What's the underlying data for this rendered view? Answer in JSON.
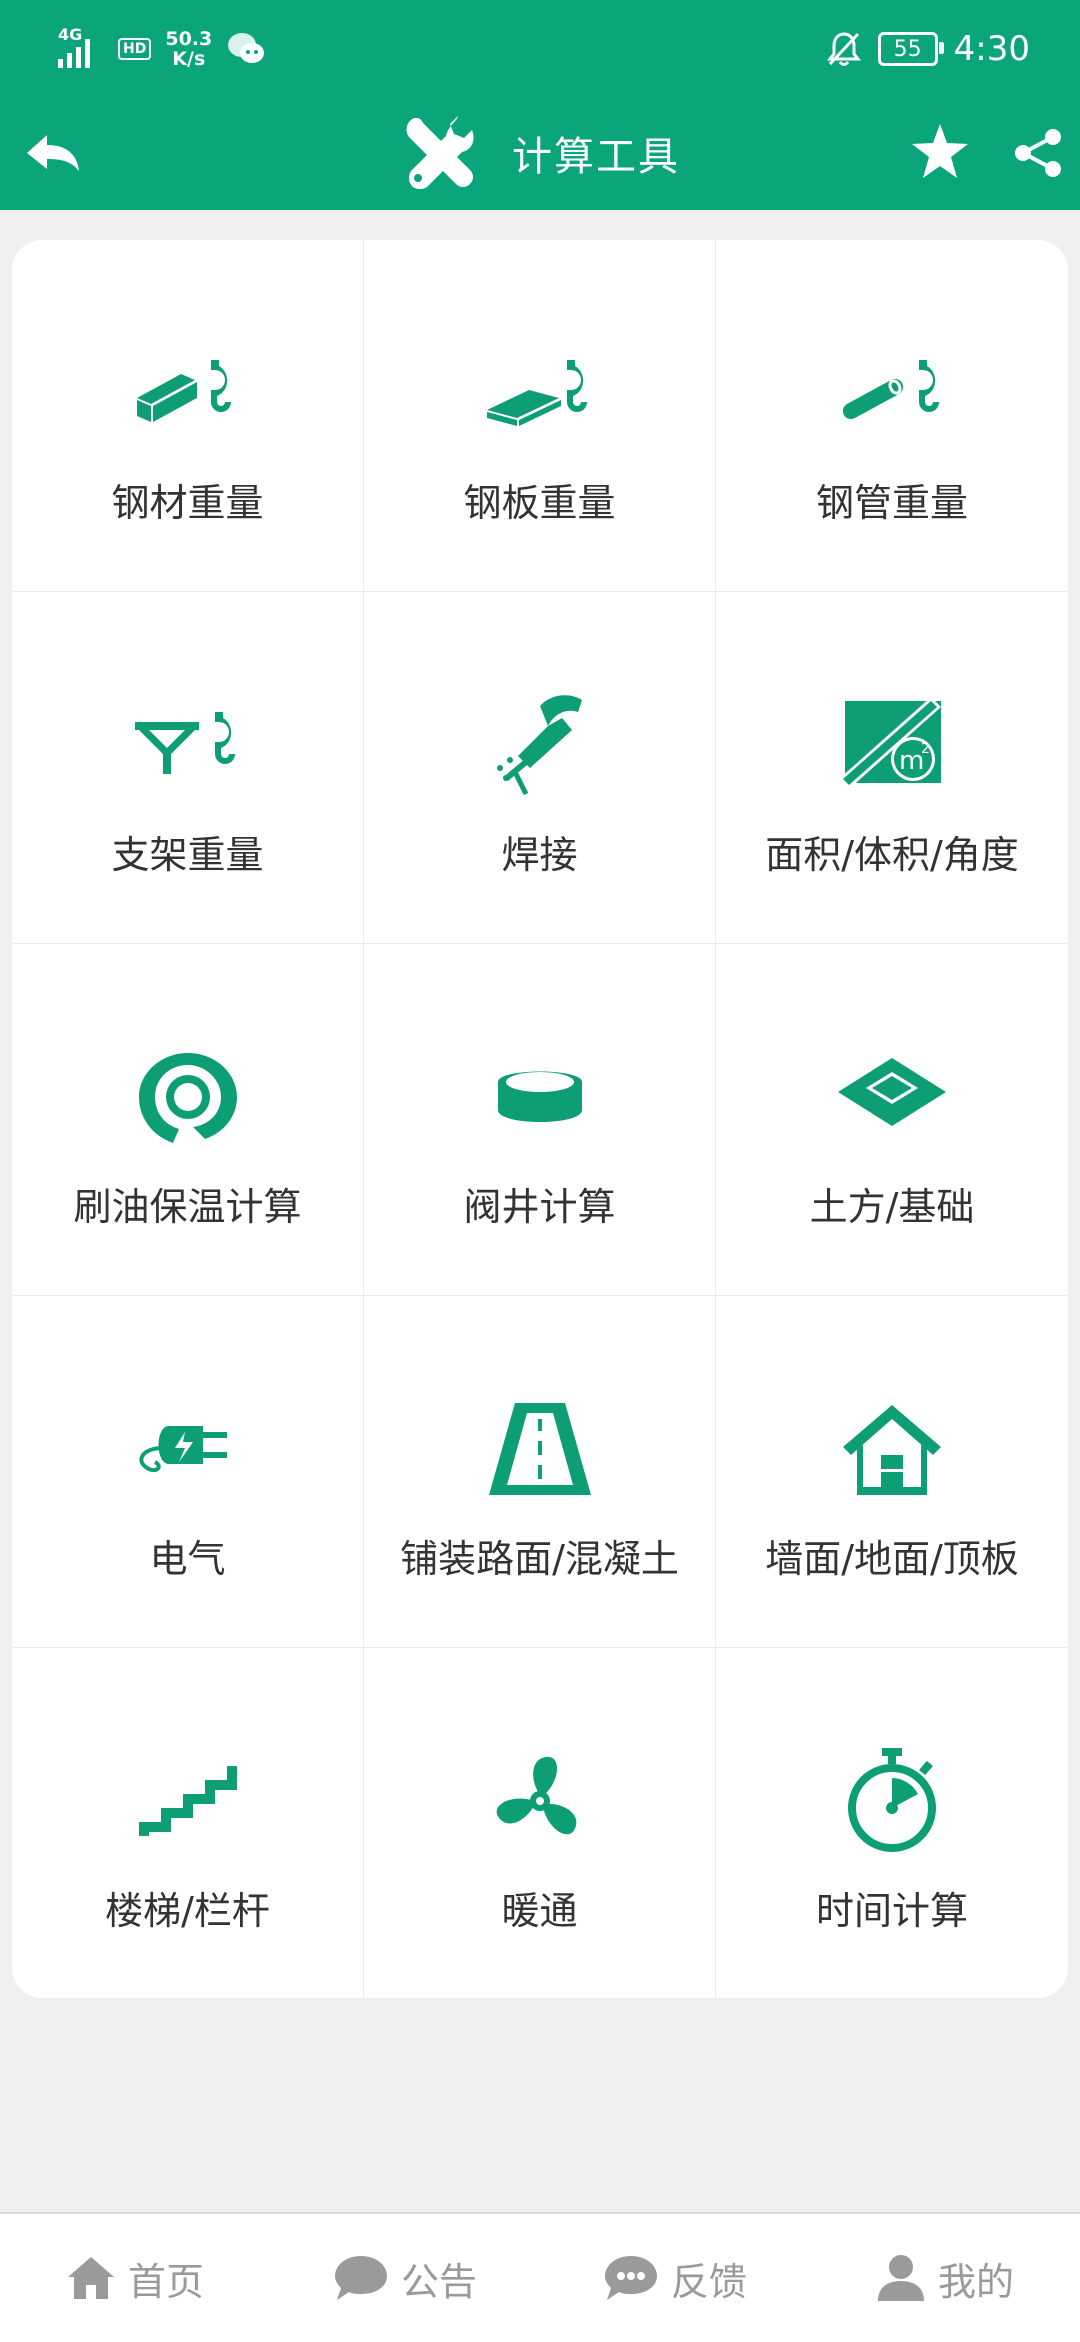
{
  "status_bar": {
    "network": "4G",
    "hd": "HD",
    "speed_value": "50.3",
    "speed_unit": "K/s",
    "battery": "55",
    "time": "4:30"
  },
  "header": {
    "title": "计算工具"
  },
  "tools": [
    {
      "label": "钢材重量",
      "icon": "steel-bar-hook-icon"
    },
    {
      "label": "钢板重量",
      "icon": "steel-plate-hook-icon"
    },
    {
      "label": "钢管重量",
      "icon": "steel-pipe-hook-icon"
    },
    {
      "label": "支架重量",
      "icon": "bracket-hook-icon"
    },
    {
      "label": "焊接",
      "icon": "welding-torch-icon"
    },
    {
      "label": "面积/体积/角度",
      "icon": "ruler-area-icon"
    },
    {
      "label": "刷油保温计算",
      "icon": "insulation-ring-icon"
    },
    {
      "label": "阀井计算",
      "icon": "valve-well-icon"
    },
    {
      "label": "土方/基础",
      "icon": "earthwork-icon"
    },
    {
      "label": "电气",
      "icon": "electric-plug-icon"
    },
    {
      "label": "铺装路面/混凝土",
      "icon": "road-icon"
    },
    {
      "label": "墙面/地面/顶板",
      "icon": "house-icon"
    },
    {
      "label": "楼梯/栏杆",
      "icon": "stairs-icon"
    },
    {
      "label": "暖通",
      "icon": "fan-icon"
    },
    {
      "label": "时间计算",
      "icon": "stopwatch-icon"
    }
  ],
  "bottom_nav": [
    {
      "label": "首页",
      "icon": "home-icon"
    },
    {
      "label": "公告",
      "icon": "chat-bubble-icon"
    },
    {
      "label": "反馈",
      "icon": "feedback-bubble-icon"
    },
    {
      "label": "我的",
      "icon": "user-icon"
    }
  ],
  "colors": {
    "brand": "#0aa57a",
    "icon": "#0d9e76",
    "nav": "#9a9a9a",
    "label": "#333333"
  }
}
